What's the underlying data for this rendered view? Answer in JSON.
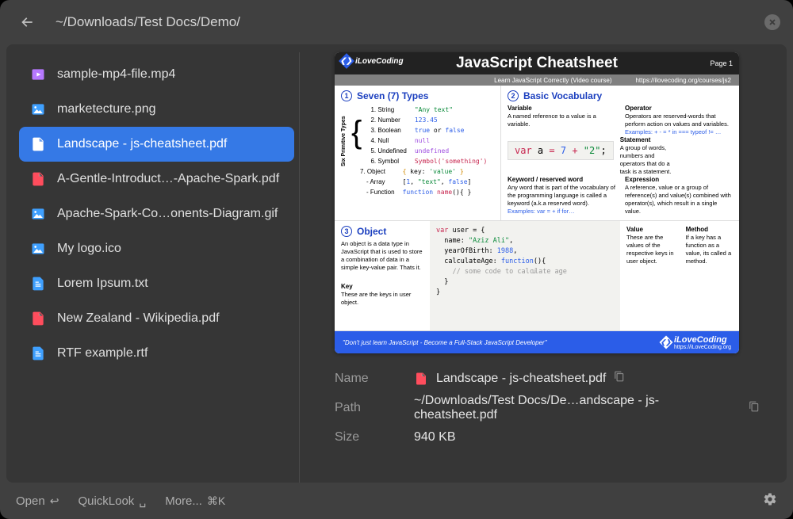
{
  "header": {
    "breadcrumb": "~/Downloads/Test Docs/Demo/"
  },
  "files": [
    {
      "name": "sample-mp4-file.mp4",
      "icon": "video",
      "selected": false
    },
    {
      "name": "marketecture.png",
      "icon": "image",
      "selected": false
    },
    {
      "name": "Landscape - js-cheatsheet.pdf",
      "icon": "pdf",
      "selected": true
    },
    {
      "name": "A-Gentle-Introduct…-Apache-Spark.pdf",
      "icon": "pdf",
      "selected": false
    },
    {
      "name": "Apache-Spark-Co…onents-Diagram.gif",
      "icon": "image",
      "selected": false
    },
    {
      "name": "My logo.ico",
      "icon": "image",
      "selected": false
    },
    {
      "name": "Lorem Ipsum.txt",
      "icon": "text",
      "selected": false
    },
    {
      "name": "New Zealand - Wikipedia.pdf",
      "icon": "pdf",
      "selected": false
    },
    {
      "name": "RTF example.rtf",
      "icon": "text",
      "selected": false
    }
  ],
  "preview": {
    "brand": "iLoveCoding",
    "title": "JavaScript Cheatsheet",
    "page_label": "Page 1",
    "sub_left": "Learn JavaScript Correctly (Video course)",
    "sub_right": "https://ilovecoding.org/courses/js2",
    "sec1_title": "Seven (7) Types",
    "side_label": "Six Primitive Types",
    "types": [
      "String",
      "Number",
      "Boolean",
      "Null",
      "Undefined",
      "Symbol"
    ],
    "type_vals": [
      "\"Any text\"",
      "123.45",
      "true or false",
      "null",
      "undefined",
      "Symbol('something')"
    ],
    "type7": "Object",
    "type7_sub1": "- Array",
    "type7_sub2": "- Function",
    "val7a": "{ key: 'value' }",
    "val7b": "[1, \"text\", false]",
    "val7c": "function name(){ }",
    "sec2_title": "Basic Vocabulary",
    "var_lbl": "Variable",
    "var_txt": "A named reference to a value is a variable.",
    "op_lbl": "Operator",
    "op_txt": "Operators are reserved-words that perform action on values and variables.",
    "op_ex": "Examples: + - = * in === typeof != …",
    "code_line": "var a = 7 + \"2\";",
    "stmt_lbl": "Statement",
    "stmt_txt": "A group of words, numbers and operators that do a task is a statement.",
    "kw_lbl": "Keyword / reserved word",
    "kw_txt": "Any word that is part of the vocabulary of the programming language is called a keyword (a.k.a reserved word).",
    "kw_ex": "Examples: var = + if for…",
    "expr_lbl": "Expression",
    "expr_txt": "A reference, value or a group of reference(s) and value(s) combined with operator(s), which result in a single value.",
    "sec3_title": "Object",
    "obj_desc": "An object is a data type in JavaScript that is used to store a combination of data in a simple key-value pair. Thats it.",
    "obj_code": "var user = {\n  name: \"Aziz Ali\",\n  yearOfBirth: 1988,\n  calculateAge: function(){\n    // some code to calculate age\n  }\n}",
    "key_lbl": "Key",
    "key_txt": "These are the keys in user object.",
    "value_lbl": "Value",
    "value_txt": "These are the values of the respective keys in user object.",
    "method_lbl": "Method",
    "method_txt": "If a key has a function as a value, its called a method.",
    "footer_tag": "\"Don't just learn JavaScript - Become a Full-Stack JavaScript Developer\"",
    "footer_url": "https://iLoveCoding.org"
  },
  "meta": {
    "name_label": "Name",
    "name_value": "Landscape - js-cheatsheet.pdf",
    "path_label": "Path",
    "path_value": "~/Downloads/Test Docs/De…andscape - js-cheatsheet.pdf",
    "size_label": "Size",
    "size_value": "940 KB"
  },
  "footer": {
    "open": "Open",
    "open_key": "↩",
    "quicklook": "QuickLook",
    "quicklook_key": "␣",
    "more": "More...",
    "more_key": "⌘K"
  }
}
